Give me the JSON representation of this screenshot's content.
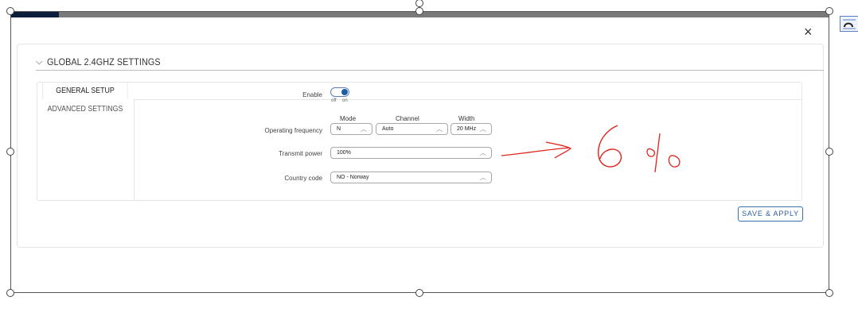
{
  "progress": {
    "fraction": 0.059
  },
  "close_glyph": "×",
  "section": {
    "chevron": "⌵",
    "title": "GLOBAL 2.4GHZ SETTINGS"
  },
  "tabs": [
    {
      "label": "GENERAL SETUP",
      "active": true
    },
    {
      "label": "ADVANCED SETTINGS",
      "active": false
    }
  ],
  "enable": {
    "label": "Enable",
    "off": "off",
    "on": "on",
    "state": "on"
  },
  "frequency": {
    "label": "Operating frequency",
    "mode": {
      "header": "Mode",
      "value": "N"
    },
    "channel": {
      "header": "Channel",
      "value": "Auto"
    },
    "width": {
      "header": "Width",
      "value": "20 MHz"
    }
  },
  "transmit_power": {
    "label": "Transmit power",
    "value": "100%"
  },
  "country_code": {
    "label": "Country code",
    "value": "NO - Norway"
  },
  "save_apply": "SAVE & APPLY",
  "handwritten_note": "6 %",
  "colors": {
    "accent": "#1a5ea8",
    "annotation": "#e0241b",
    "progress_fill": "#0b1f3c",
    "progress_track": "#7a7a7a"
  },
  "icons": [
    "close-icon",
    "chevron-down-icon",
    "caret-up-icon",
    "layout-options-icon"
  ]
}
